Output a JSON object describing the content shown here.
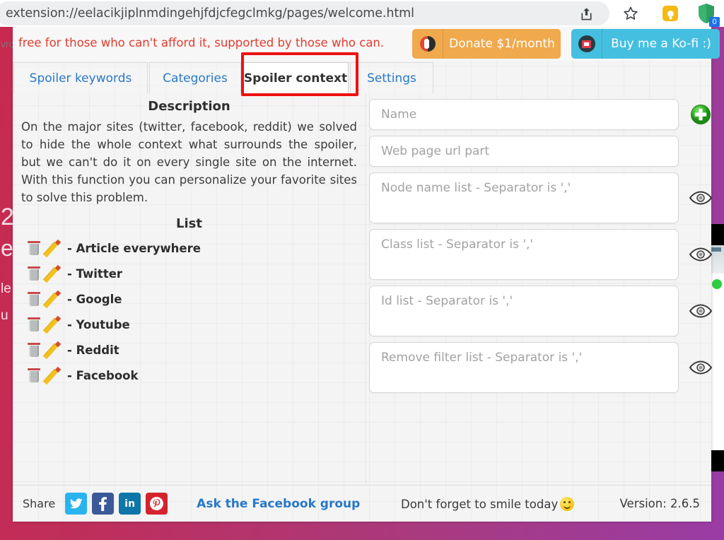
{
  "browser": {
    "omnibox_url": "extension://eelacikjiplnmdingehjfdjcfegclmkg/pages/welcome.html",
    "share_icon": "share-icon",
    "bookmark_icon": "star-icon",
    "extension_icon": "lightbulb-extension-icon",
    "shield_icon": "shield-icon",
    "shield_badge_count": "0"
  },
  "underlying_page": {
    "snippets": [
      "vrc",
      "2",
      "e",
      "le",
      "u"
    ]
  },
  "promo": {
    "message": "free for those who can't afford it, supported by those who can.",
    "message_color": "#e23b2e",
    "donate_label": "Donate $1/month",
    "donate_icon": "patreon-icon",
    "donate_color": "#f0a94c",
    "kofi_label": "Buy me a Ko-fi :)",
    "kofi_icon": "kofi-cup-icon",
    "kofi_color": "#45bfe0"
  },
  "tabs": [
    {
      "label": "Spoiler keywords",
      "active": false
    },
    {
      "label": "Categories",
      "active": false
    },
    {
      "label": "Spoiler context",
      "active": true
    },
    {
      "label": "Settings",
      "active": false
    }
  ],
  "highlight": {
    "color": "#ee1111",
    "target": "Spoiler context"
  },
  "left": {
    "description_heading": "Description",
    "description_text": "On the major sites (twitter, facebook, reddit) we solved to hide the whole context what surrounds the spoiler, but we can't do it on every single site on the internet. With this function you can personalize your favorite sites to solve this problem.",
    "list_heading": "List",
    "list_items": [
      {
        "label": "- Article everywhere",
        "delete_icon": "trash-icon",
        "edit_icon": "pencil-icon"
      },
      {
        "label": "- Twitter",
        "delete_icon": "trash-icon",
        "edit_icon": "pencil-icon"
      },
      {
        "label": "- Google",
        "delete_icon": "trash-icon",
        "edit_icon": "pencil-icon"
      },
      {
        "label": "- Youtube",
        "delete_icon": "trash-icon",
        "edit_icon": "pencil-icon"
      },
      {
        "label": "- Reddit",
        "delete_icon": "trash-icon",
        "edit_icon": "pencil-icon"
      },
      {
        "label": "- Facebook",
        "delete_icon": "trash-icon",
        "edit_icon": "pencil-icon"
      }
    ]
  },
  "form": {
    "name_placeholder": "Name",
    "url_part_placeholder": "Web page url part",
    "node_name_placeholder": "Node name list - Separator is ','",
    "class_list_placeholder": "Class list - Separator is ','",
    "id_list_placeholder": "Id list  - Separator is ','",
    "remove_filter_placeholder": "Remove filter list - Separator is ','",
    "add_icon": "plus-circle-icon",
    "add_icon_color": "#35b734",
    "preview_icon": "eye-icon"
  },
  "footer": {
    "share_label": "Share",
    "share_buttons": [
      {
        "name": "twitter",
        "glyph": "ᵗ",
        "color": "#29b4ef"
      },
      {
        "name": "facebook",
        "glyph": "f",
        "color": "#3b5998"
      },
      {
        "name": "linkedin",
        "glyph": "in",
        "color": "#0e76a8"
      },
      {
        "name": "pinterest",
        "glyph": "ⓟ",
        "color": "#d5232e"
      }
    ],
    "ask_group_link": "Ask the Facebook group",
    "smile_message": "Don't forget to smile today",
    "smile_icon": "smiley-face-icon",
    "version_label": "Version: 2.6.5"
  }
}
